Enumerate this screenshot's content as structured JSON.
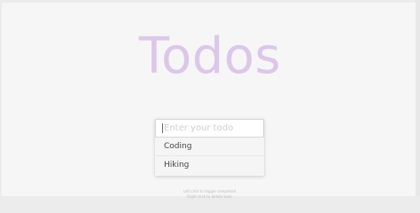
{
  "title": "Todos",
  "input": {
    "placeholder": "Enter your todo",
    "value": ""
  },
  "todos": [
    {
      "label": "Coding"
    },
    {
      "label": "Hiking"
    }
  ],
  "hints": {
    "line1": "Left click to toggle completed.",
    "line2": "Right click to delete todo."
  }
}
